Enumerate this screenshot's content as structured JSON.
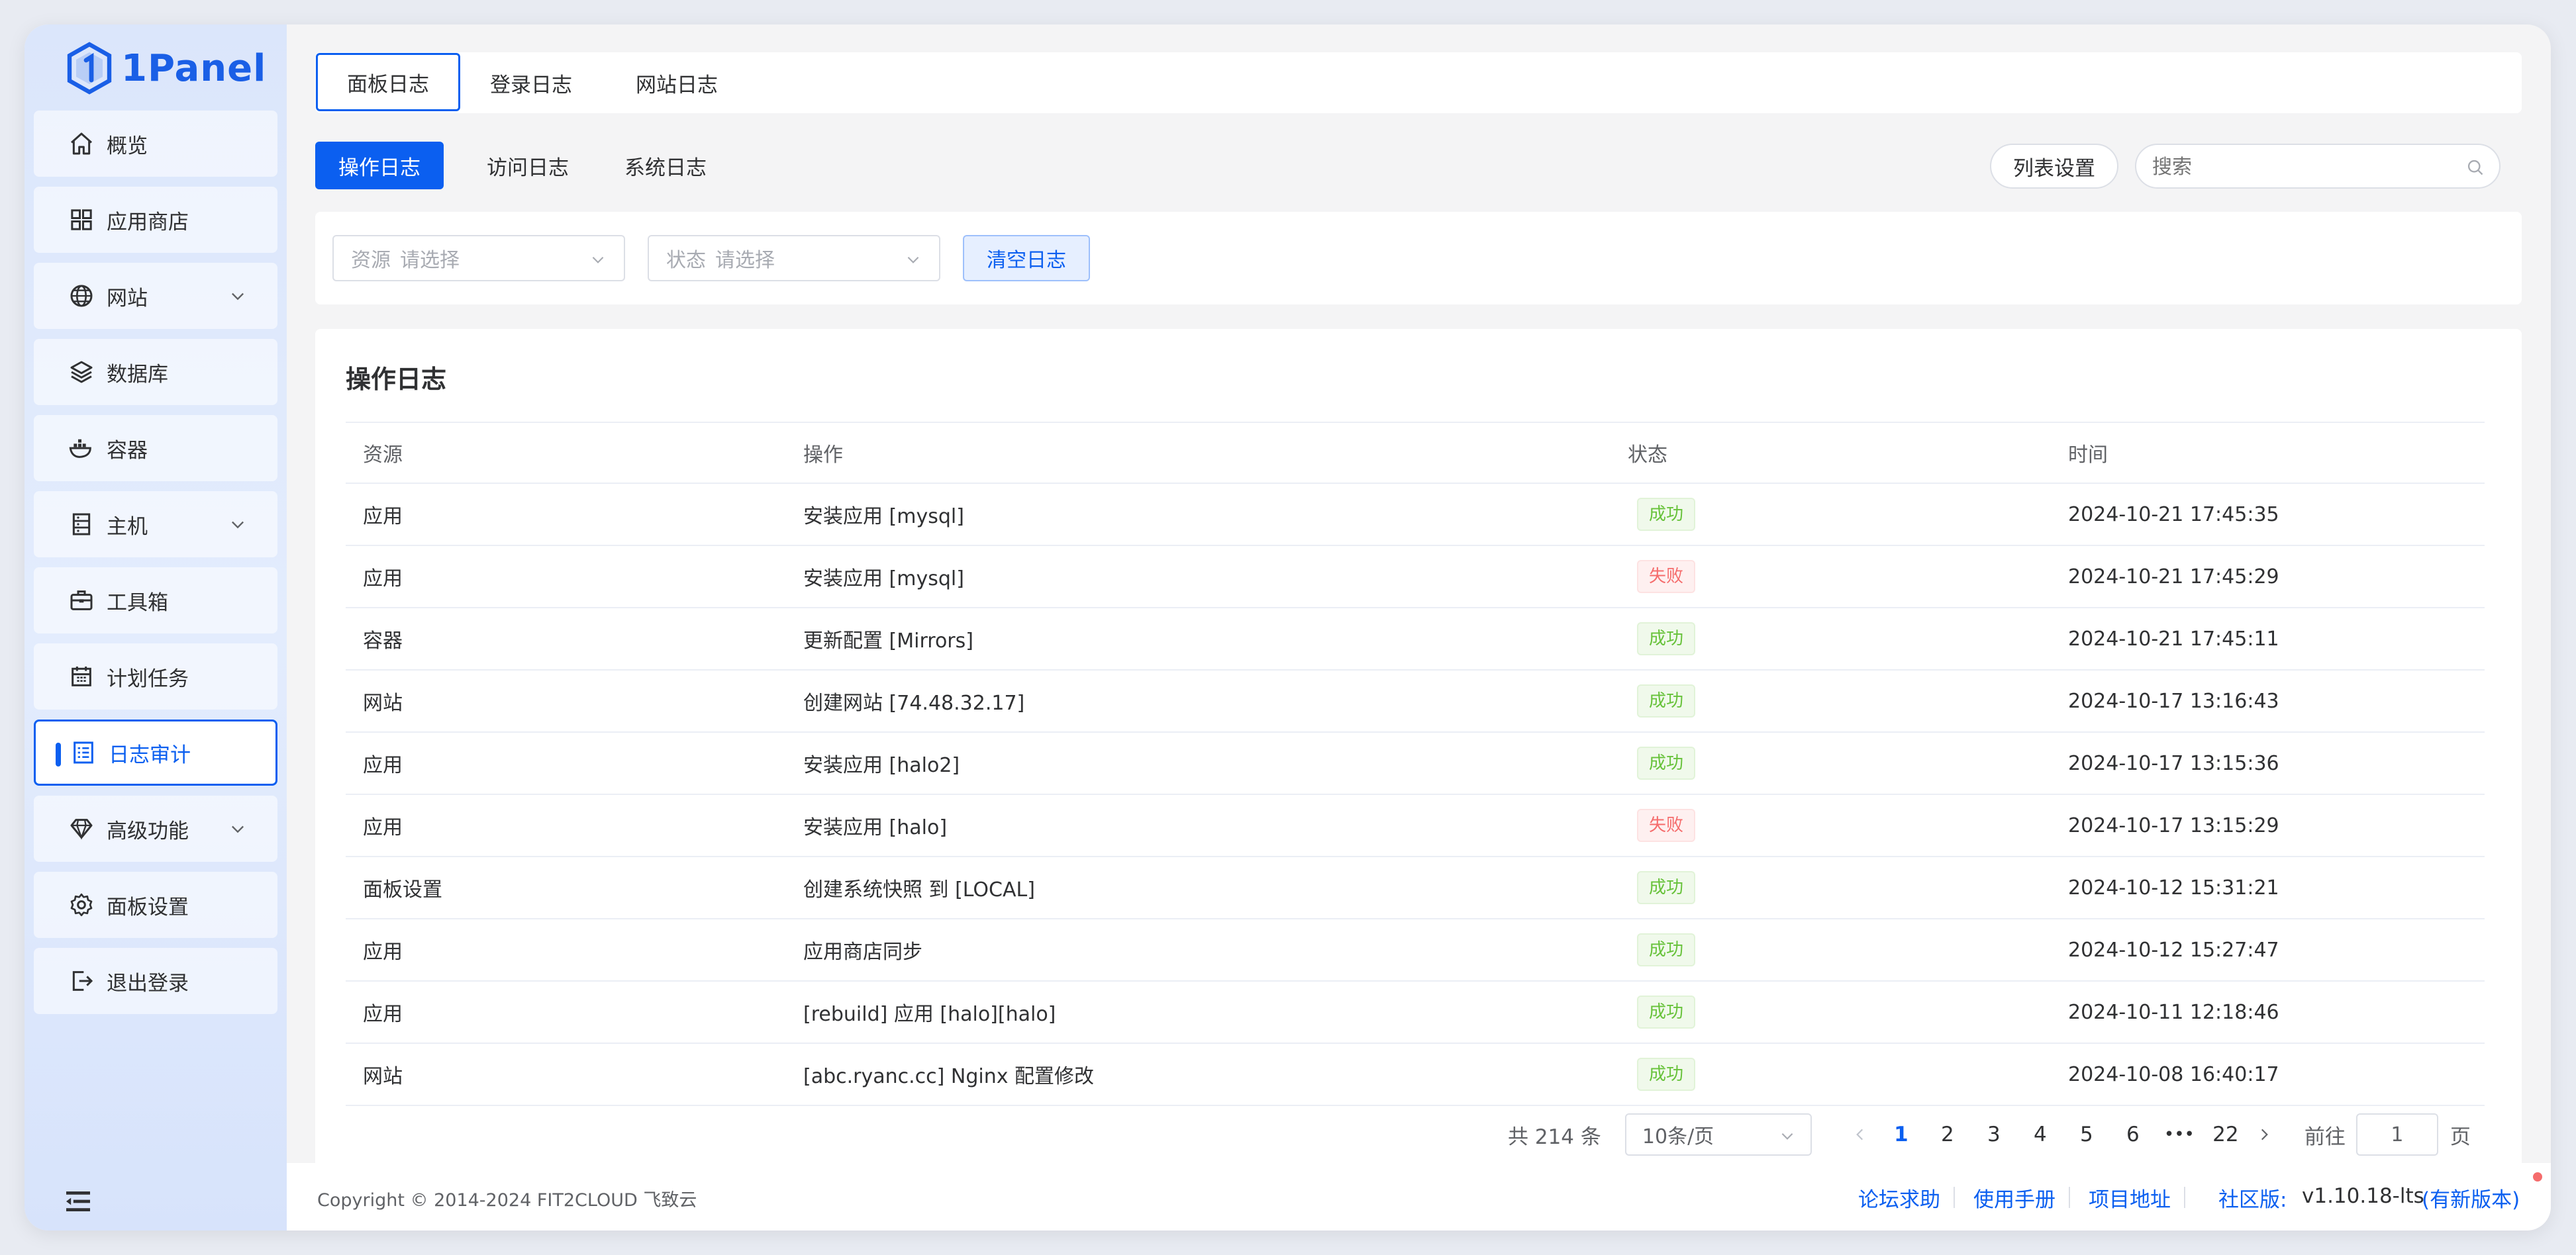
{
  "brand": {
    "name": "1Panel",
    "color": "#0b5ff0"
  },
  "sidebar": {
    "items": [
      {
        "label": "概览",
        "icon": "home-icon"
      },
      {
        "label": "应用商店",
        "icon": "grid-icon"
      },
      {
        "label": "网站",
        "icon": "globe-icon",
        "has_submenu": true
      },
      {
        "label": "数据库",
        "icon": "layers-icon"
      },
      {
        "label": "容器",
        "icon": "docker-icon"
      },
      {
        "label": "主机",
        "icon": "server-icon",
        "has_submenu": true
      },
      {
        "label": "工具箱",
        "icon": "toolbox-icon"
      },
      {
        "label": "计划任务",
        "icon": "calendar-icon"
      },
      {
        "label": "日志审计",
        "icon": "log-icon",
        "active": true
      },
      {
        "label": "高级功能",
        "icon": "diamond-icon",
        "has_submenu": true
      },
      {
        "label": "面板设置",
        "icon": "gear-icon"
      },
      {
        "label": "退出登录",
        "icon": "logout-icon"
      }
    ]
  },
  "top_tabs": [
    "面板日志",
    "登录日志",
    "网站日志"
  ],
  "sub_tabs": [
    "操作日志",
    "访问日志",
    "系统日志"
  ],
  "toolbar": {
    "columns_button": "列表设置",
    "search_placeholder": "搜索"
  },
  "filters": {
    "resource": {
      "label": "资源",
      "placeholder": "请选择"
    },
    "status": {
      "label": "状态",
      "placeholder": "请选择"
    },
    "clear_button": "清空日志"
  },
  "table": {
    "title": "操作日志",
    "columns": [
      "资源",
      "操作",
      "状态",
      "时间"
    ],
    "rows": [
      {
        "resource": "应用",
        "action": "安装应用 [mysql]",
        "status": "成功",
        "ok": true,
        "time": "2024-10-21 17:45:35"
      },
      {
        "resource": "应用",
        "action": "安装应用 [mysql]",
        "status": "失败",
        "ok": false,
        "time": "2024-10-21 17:45:29"
      },
      {
        "resource": "容器",
        "action": "更新配置 [Mirrors]",
        "status": "成功",
        "ok": true,
        "time": "2024-10-21 17:45:11"
      },
      {
        "resource": "网站",
        "action": "创建网站 [74.48.32.17]",
        "status": "成功",
        "ok": true,
        "time": "2024-10-17 13:16:43"
      },
      {
        "resource": "应用",
        "action": "安装应用 [halo2]",
        "status": "成功",
        "ok": true,
        "time": "2024-10-17 13:15:36"
      },
      {
        "resource": "应用",
        "action": "安装应用 [halo]",
        "status": "失败",
        "ok": false,
        "time": "2024-10-17 13:15:29"
      },
      {
        "resource": "面板设置",
        "action": "创建系统快照 到 [LOCAL]",
        "status": "成功",
        "ok": true,
        "time": "2024-10-12 15:31:21"
      },
      {
        "resource": "应用",
        "action": "应用商店同步",
        "status": "成功",
        "ok": true,
        "time": "2024-10-12 15:27:47"
      },
      {
        "resource": "应用",
        "action": "[rebuild] 应用 [halo][halo]",
        "status": "成功",
        "ok": true,
        "time": "2024-10-11 12:18:46"
      },
      {
        "resource": "网站",
        "action": "[abc.ryanc.cc] Nginx 配置修改",
        "status": "成功",
        "ok": true,
        "time": "2024-10-08 16:40:17"
      }
    ]
  },
  "pagination": {
    "total": "共 214 条",
    "page_size": "10条/页",
    "pages": [
      "1",
      "2",
      "3",
      "4",
      "5",
      "6"
    ],
    "ellipsis": "•••",
    "last": "22",
    "current": "1",
    "goto_label": "前往",
    "goto_value": "1",
    "goto_suffix": "页"
  },
  "footer": {
    "copyright": "Copyright © 2014-2024 FIT2CLOUD 飞致云",
    "links": [
      "论坛求助",
      "使用手册",
      "项目地址"
    ],
    "edition_label": "社区版:",
    "version": "v1.10.18-lts",
    "update_link": "(有新版本)"
  }
}
